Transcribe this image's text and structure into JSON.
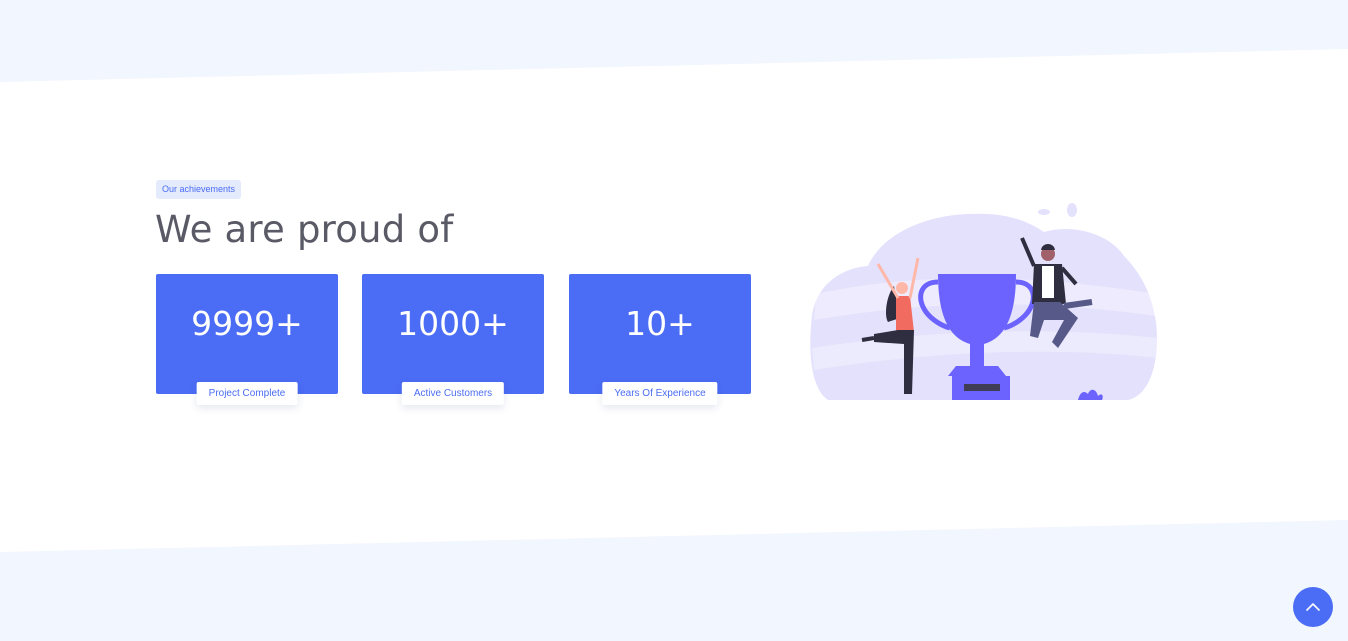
{
  "achievements": {
    "badge": "Our achievements",
    "heading": "We are proud of",
    "stats": [
      {
        "value": "9999+",
        "label": "Project Complete"
      },
      {
        "value": "1000+",
        "label": "Active Customers"
      },
      {
        "value": "10+",
        "label": "Years Of Experience"
      }
    ]
  },
  "colors": {
    "accent": "#4b6cf4",
    "page_background": "#f2f6fe",
    "section_background": "#ffffff",
    "illustration_blob": "#e4e1fc",
    "trophy": "#6c63ff"
  },
  "icons": {
    "scroll_top": "chevron-up-icon"
  }
}
